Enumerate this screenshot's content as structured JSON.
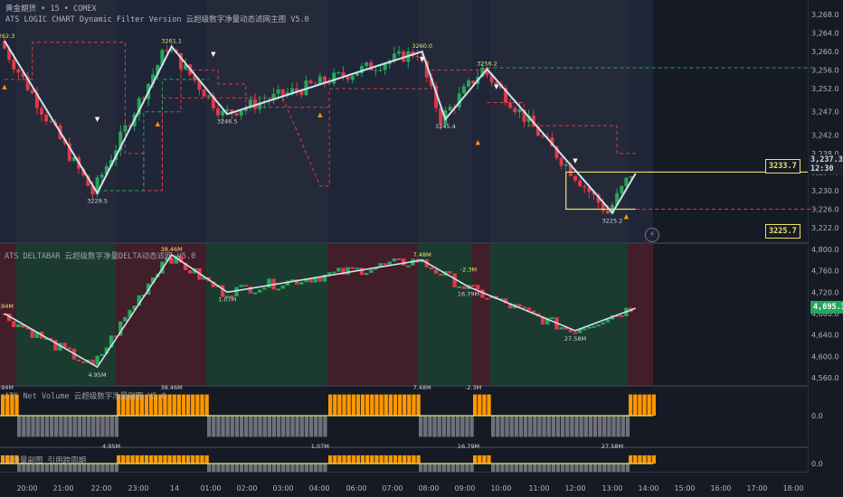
{
  "header": {
    "symbol": "黄金期货",
    "interval": "15",
    "exchange": "COMEX",
    "sep": "•",
    "indicator": "ATS LOGIC CHART Dynamic Filter Version 云超级数字净量动态滤网主图 V5.0"
  },
  "pane2_title": "ATS DELTABAR 云超级数字净量DELTA动态滤网 V5.0",
  "pane3_title": "ATS Net Volume 云超级数字净量副图 V5.0",
  "pane4_title": "云净量副图 引用跨周期",
  "colors": {
    "bg": "#161a25",
    "up": "#26a65b",
    "down": "#e0394a",
    "zig": "#cfe3f0",
    "orange": "#ff9800",
    "gray": "#787b86",
    "yellow": "#e9e36a"
  },
  "price_axis": [
    "3,268.0",
    "3,264.0",
    "3,260.0",
    "3,256.0",
    "3,252.0",
    "3,247.0",
    "3,242.0",
    "3,238.0",
    "3,234.0",
    "3,230.0",
    "3,226.0",
    "3,222.0"
  ],
  "price_last": "3,237.3",
  "price_countdown": "12:30",
  "price_high_box": "3233.7",
  "price_low_box": "3225.7",
  "delta_axis": [
    "4,800.0",
    "4,760.0",
    "4,720.0",
    "4,680.0",
    "4,640.0",
    "4,600.0",
    "4,560.0"
  ],
  "delta_last": "4,695.3",
  "nv_axis": "0.0",
  "nv2_axis": "0.0",
  "time_axis": [
    "20:00",
    "21:00",
    "22:00",
    "23:00",
    "14",
    "01:00",
    "02:00",
    "03:00",
    "04:00",
    "06:00",
    "07:00",
    "08:00",
    "09:00",
    "10:00",
    "11:00",
    "12:00",
    "13:00",
    "14:00",
    "15:00",
    "16:00",
    "17:00",
    "18:00"
  ],
  "main_labels": [
    "3262.3",
    "3261.1",
    "3260.0",
    "3256.2",
    "3246.5",
    "3245.4",
    "3229.5",
    "3225.2"
  ],
  "delta_labels": [
    "2.94M",
    "38.46M",
    "1.07M",
    "7.48M",
    "-2.3M",
    "16.79M",
    "4.95M",
    "27.58M"
  ],
  "nv_labels": [
    "2.94M",
    "38.46M",
    "7.48M",
    "-2.3M",
    "4.95M",
    "1.07M",
    "16.79M",
    "27.58M"
  ]
}
